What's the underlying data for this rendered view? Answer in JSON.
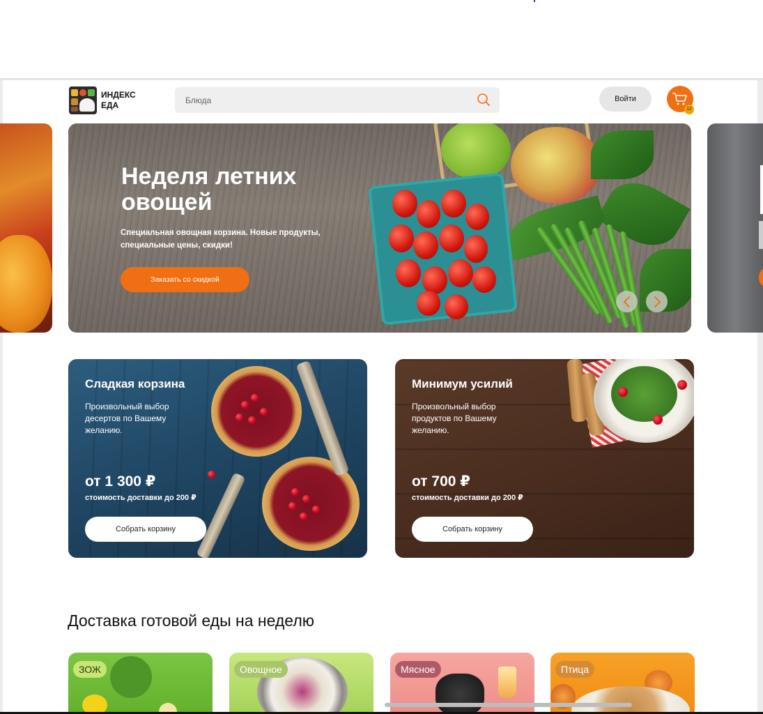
{
  "header": {
    "logo_line1": "ИНДЕКС",
    "logo_line2": "ЕДА",
    "search_placeholder": "Блюда",
    "login_label": "Войти",
    "cart_count": "12",
    "accent": "#f06f12"
  },
  "hero": {
    "title": "Неделя летних овощей",
    "subtitle": "Специальная овощная корзина. Новые продукты, специальные цены, скидки!",
    "button_label": "Заказать со скидкой"
  },
  "promos": [
    {
      "title": "Сладкая корзина",
      "description": "Произвольный выбор десертов по Вашему желанию.",
      "price": "от 1 300 ₽",
      "delivery": "стоимость доставки до 200 ₽",
      "button_label": "Собрать корзину"
    },
    {
      "title": "Минимум усилий",
      "description": "Произвольный выбор продуктов по Вашему желанию.",
      "price": "от 700 ₽",
      "delivery": "стоимость доставки до 200 ₽",
      "button_label": "Собрать корзину"
    }
  ],
  "section": {
    "title": "Доставка готовой еды на неделю",
    "categories": [
      {
        "label": "ЗОЖ"
      },
      {
        "label": "Овощное"
      },
      {
        "label": "Мясное"
      },
      {
        "label": "Птица"
      }
    ]
  },
  "icons": [
    "search-icon",
    "cart-icon",
    "chevron-left-icon",
    "chevron-right-icon"
  ]
}
